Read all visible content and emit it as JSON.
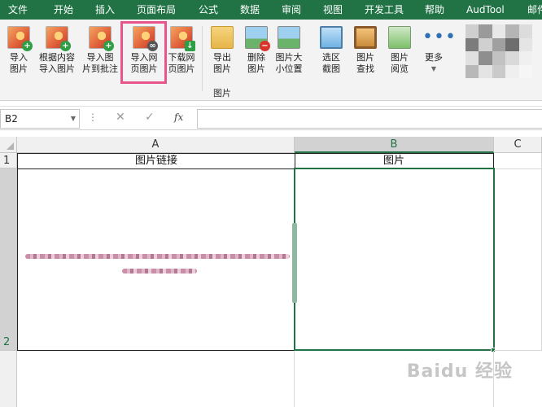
{
  "menu": {
    "items": [
      "文件",
      "开始",
      "插入",
      "页面布局",
      "公式",
      "数据",
      "审阅",
      "视图",
      "开发工具",
      "帮助",
      "AudTool",
      "邮件"
    ]
  },
  "ribbon": {
    "buttons": [
      {
        "label": "导入\n图片"
      },
      {
        "label": "根据内容\n导入图片"
      },
      {
        "label": "导入图\n片到批注"
      },
      {
        "label": "导入网\n页图片"
      },
      {
        "label": "下载网\n页图片"
      },
      {
        "label": "导出\n图片"
      },
      {
        "label": "删除\n图片"
      },
      {
        "label": "图片大\n小位置"
      },
      {
        "label": "选区\n截图"
      },
      {
        "label": "图片\n查找"
      },
      {
        "label": "图片\n阅览"
      },
      {
        "label": "更多"
      }
    ],
    "group_label": "图片"
  },
  "formula_bar": {
    "name_box": "B2",
    "fx": "fx",
    "value": ""
  },
  "sheet": {
    "columns": [
      "A",
      "B",
      "C"
    ],
    "rows": [
      "1",
      "2"
    ],
    "cells": {
      "A1": "图片链接",
      "B1": "图片"
    },
    "active_cell": "B2"
  },
  "watermark": "Baidu 经验",
  "colors": {
    "excel_green": "#217346",
    "highlight": "#e8558c"
  }
}
